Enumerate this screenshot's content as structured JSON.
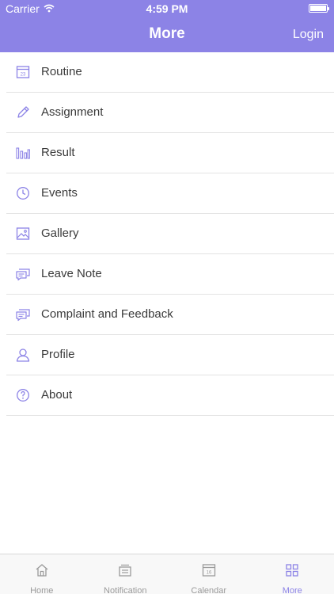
{
  "status_bar": {
    "carrier": "Carrier",
    "time": "4:59 PM"
  },
  "navbar": {
    "title": "More",
    "login_label": "Login"
  },
  "colors": {
    "brand": "#8c83e6",
    "tab_inactive": "#9a9a9a"
  },
  "menu": {
    "items": [
      {
        "label": "Routine",
        "icon": "calendar-icon",
        "calendar_day": "23"
      },
      {
        "label": "Assignment",
        "icon": "pencil-icon"
      },
      {
        "label": "Result",
        "icon": "bar-chart-icon"
      },
      {
        "label": "Events",
        "icon": "clock-icon"
      },
      {
        "label": "Gallery",
        "icon": "image-icon"
      },
      {
        "label": "Leave Note",
        "icon": "chat-icon"
      },
      {
        "label": "Complaint and Feedback",
        "icon": "chat-icon"
      },
      {
        "label": "Profile",
        "icon": "user-icon"
      },
      {
        "label": "About",
        "icon": "question-icon"
      }
    ]
  },
  "tabbar": {
    "tabs": [
      {
        "label": "Home",
        "icon": "home-icon",
        "active": false
      },
      {
        "label": "Notification",
        "icon": "notification-icon",
        "active": false
      },
      {
        "label": "Calendar",
        "icon": "calendar-icon",
        "calendar_day": "16",
        "active": false
      },
      {
        "label": "More",
        "icon": "grid-icon",
        "active": true
      }
    ]
  }
}
